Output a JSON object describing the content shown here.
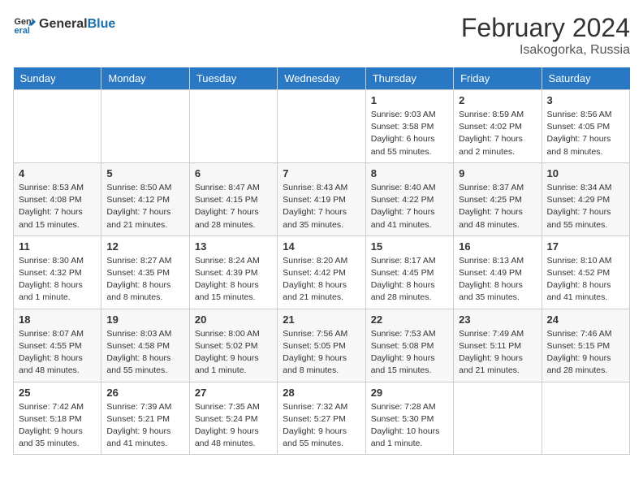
{
  "header": {
    "logo_general": "General",
    "logo_blue": "Blue",
    "month": "February 2024",
    "location": "Isakogorka, Russia"
  },
  "days_of_week": [
    "Sunday",
    "Monday",
    "Tuesday",
    "Wednesday",
    "Thursday",
    "Friday",
    "Saturday"
  ],
  "weeks": [
    [
      {
        "day": "",
        "content": ""
      },
      {
        "day": "",
        "content": ""
      },
      {
        "day": "",
        "content": ""
      },
      {
        "day": "",
        "content": ""
      },
      {
        "day": "1",
        "content": "Sunrise: 9:03 AM\nSunset: 3:58 PM\nDaylight: 6 hours and 55 minutes."
      },
      {
        "day": "2",
        "content": "Sunrise: 8:59 AM\nSunset: 4:02 PM\nDaylight: 7 hours and 2 minutes."
      },
      {
        "day": "3",
        "content": "Sunrise: 8:56 AM\nSunset: 4:05 PM\nDaylight: 7 hours and 8 minutes."
      }
    ],
    [
      {
        "day": "4",
        "content": "Sunrise: 8:53 AM\nSunset: 4:08 PM\nDaylight: 7 hours and 15 minutes."
      },
      {
        "day": "5",
        "content": "Sunrise: 8:50 AM\nSunset: 4:12 PM\nDaylight: 7 hours and 21 minutes."
      },
      {
        "day": "6",
        "content": "Sunrise: 8:47 AM\nSunset: 4:15 PM\nDaylight: 7 hours and 28 minutes."
      },
      {
        "day": "7",
        "content": "Sunrise: 8:43 AM\nSunset: 4:19 PM\nDaylight: 7 hours and 35 minutes."
      },
      {
        "day": "8",
        "content": "Sunrise: 8:40 AM\nSunset: 4:22 PM\nDaylight: 7 hours and 41 minutes."
      },
      {
        "day": "9",
        "content": "Sunrise: 8:37 AM\nSunset: 4:25 PM\nDaylight: 7 hours and 48 minutes."
      },
      {
        "day": "10",
        "content": "Sunrise: 8:34 AM\nSunset: 4:29 PM\nDaylight: 7 hours and 55 minutes."
      }
    ],
    [
      {
        "day": "11",
        "content": "Sunrise: 8:30 AM\nSunset: 4:32 PM\nDaylight: 8 hours and 1 minute."
      },
      {
        "day": "12",
        "content": "Sunrise: 8:27 AM\nSunset: 4:35 PM\nDaylight: 8 hours and 8 minutes."
      },
      {
        "day": "13",
        "content": "Sunrise: 8:24 AM\nSunset: 4:39 PM\nDaylight: 8 hours and 15 minutes."
      },
      {
        "day": "14",
        "content": "Sunrise: 8:20 AM\nSunset: 4:42 PM\nDaylight: 8 hours and 21 minutes."
      },
      {
        "day": "15",
        "content": "Sunrise: 8:17 AM\nSunset: 4:45 PM\nDaylight: 8 hours and 28 minutes."
      },
      {
        "day": "16",
        "content": "Sunrise: 8:13 AM\nSunset: 4:49 PM\nDaylight: 8 hours and 35 minutes."
      },
      {
        "day": "17",
        "content": "Sunrise: 8:10 AM\nSunset: 4:52 PM\nDaylight: 8 hours and 41 minutes."
      }
    ],
    [
      {
        "day": "18",
        "content": "Sunrise: 8:07 AM\nSunset: 4:55 PM\nDaylight: 8 hours and 48 minutes."
      },
      {
        "day": "19",
        "content": "Sunrise: 8:03 AM\nSunset: 4:58 PM\nDaylight: 8 hours and 55 minutes."
      },
      {
        "day": "20",
        "content": "Sunrise: 8:00 AM\nSunset: 5:02 PM\nDaylight: 9 hours and 1 minute."
      },
      {
        "day": "21",
        "content": "Sunrise: 7:56 AM\nSunset: 5:05 PM\nDaylight: 9 hours and 8 minutes."
      },
      {
        "day": "22",
        "content": "Sunrise: 7:53 AM\nSunset: 5:08 PM\nDaylight: 9 hours and 15 minutes."
      },
      {
        "day": "23",
        "content": "Sunrise: 7:49 AM\nSunset: 5:11 PM\nDaylight: 9 hours and 21 minutes."
      },
      {
        "day": "24",
        "content": "Sunrise: 7:46 AM\nSunset: 5:15 PM\nDaylight: 9 hours and 28 minutes."
      }
    ],
    [
      {
        "day": "25",
        "content": "Sunrise: 7:42 AM\nSunset: 5:18 PM\nDaylight: 9 hours and 35 minutes."
      },
      {
        "day": "26",
        "content": "Sunrise: 7:39 AM\nSunset: 5:21 PM\nDaylight: 9 hours and 41 minutes."
      },
      {
        "day": "27",
        "content": "Sunrise: 7:35 AM\nSunset: 5:24 PM\nDaylight: 9 hours and 48 minutes."
      },
      {
        "day": "28",
        "content": "Sunrise: 7:32 AM\nSunset: 5:27 PM\nDaylight: 9 hours and 55 minutes."
      },
      {
        "day": "29",
        "content": "Sunrise: 7:28 AM\nSunset: 5:30 PM\nDaylight: 10 hours and 1 minute."
      },
      {
        "day": "",
        "content": ""
      },
      {
        "day": "",
        "content": ""
      }
    ]
  ]
}
